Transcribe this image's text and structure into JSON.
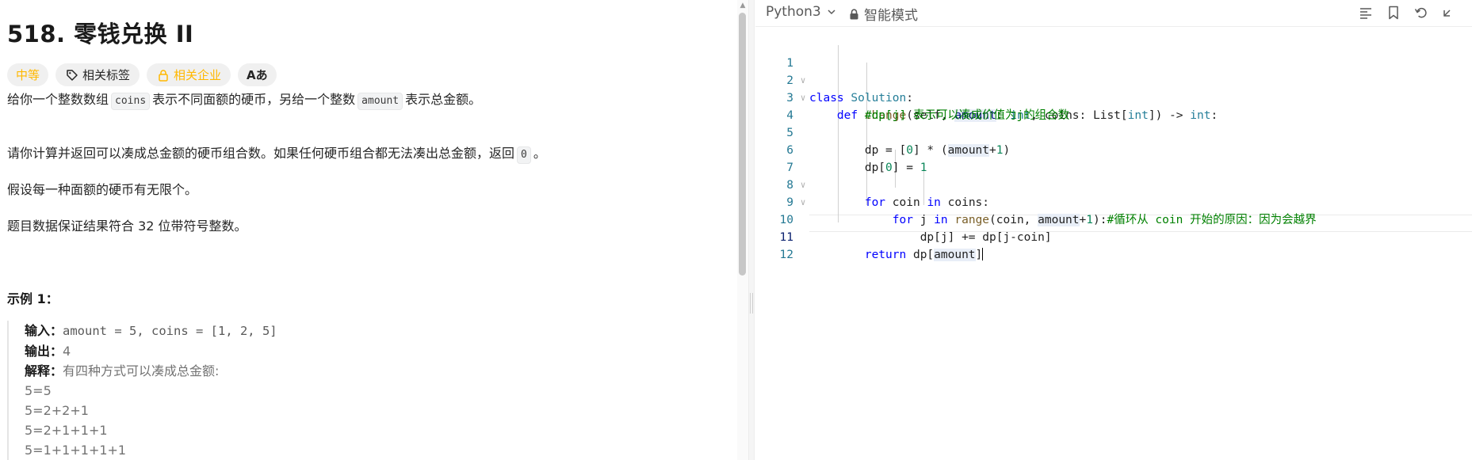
{
  "problem": {
    "title": "518. 零钱兑换 II",
    "tags": {
      "difficulty": "中等",
      "related_tags": "相关标签",
      "related_companies": "相关企业",
      "font_icon_label": "Aあ"
    },
    "paragraph1": {
      "part1": "给你一个整数数组",
      "code1": "coins",
      "part2": "表示不同面额的硬币，另给一个整数",
      "code2": "amount",
      "part3": "表示总金额。"
    },
    "paragraph2": {
      "part1": "请你计算并返回可以凑成总金额的硬币组合数。如果任何硬币组合都无法凑出总金额，返回",
      "code": "0",
      "part2": "。"
    },
    "paragraph3": "假设每一种面额的硬币有无限个。",
    "paragraph4": "题目数据保证结果符合 32 位带符号整数。",
    "example": {
      "title": "示例 1：",
      "input_label": "输入：",
      "input_value": "amount = 5, coins = [1, 2, 5]",
      "output_label": "输出：",
      "output_value": "4",
      "explain_label": "解释：",
      "explain_value": "有四种方式可以凑成总金额:",
      "lines": [
        "5=5",
        "5=2+2+1",
        "5=2+1+1+1",
        "5=1+1+1+1+1"
      ]
    }
  },
  "editor": {
    "language": "Python3",
    "mode": "智能模式",
    "line_numbers": [
      "1",
      "2",
      "3",
      "4",
      "5",
      "6",
      "7",
      "8",
      "9",
      "10",
      "11",
      "12"
    ],
    "active_line": 11,
    "code": {
      "l1_kw": "class",
      "l1_cls": "Solution",
      "l1_rest": ":",
      "l2_kw": "def",
      "l2_fn": "change",
      "l2_a": "(self, ",
      "l2_amount": "amount",
      "l2_b": ": ",
      "l2_int1": "int",
      "l2_c": ", coins: List[",
      "l2_int2": "int",
      "l2_d": "]) -> ",
      "l2_int3": "int",
      "l2_e": ":",
      "l3_cmt": "#dp[j] 表示可以凑成价值为j的组合数",
      "l5_a": "dp = [",
      "l5_num": "0",
      "l5_b": "] * (",
      "l5_amount": "amount",
      "l5_c": "+",
      "l5_num2": "1",
      "l5_d": ")",
      "l6_a": "dp[",
      "l6_num": "0",
      "l6_b": "] = ",
      "l6_num2": "1",
      "l7_kw": "for",
      "l7_a": " coin ",
      "l7_kw2": "in",
      "l7_b": " coins:",
      "l8_kw": "for",
      "l8_a": " j ",
      "l8_kw2": "in",
      "l8_b": " ",
      "l8_fn": "range",
      "l8_c": "(coin, ",
      "l8_amount": "amount",
      "l8_d": "+",
      "l8_num": "1",
      "l8_e": "):",
      "l8_cmt": "#循环从 coin 开始的原因：因为会越界",
      "l10": "dp[j] += dp[j-coin]",
      "l11_kw": "return",
      "l11_a": " dp[",
      "l11_amount": "amount",
      "l11_b": "]"
    }
  },
  "colors": {
    "difficulty_medium": "#ffb800",
    "keyword": "#0000ff",
    "class_name": "#267f99",
    "comment": "#008000",
    "number": "#098658"
  }
}
